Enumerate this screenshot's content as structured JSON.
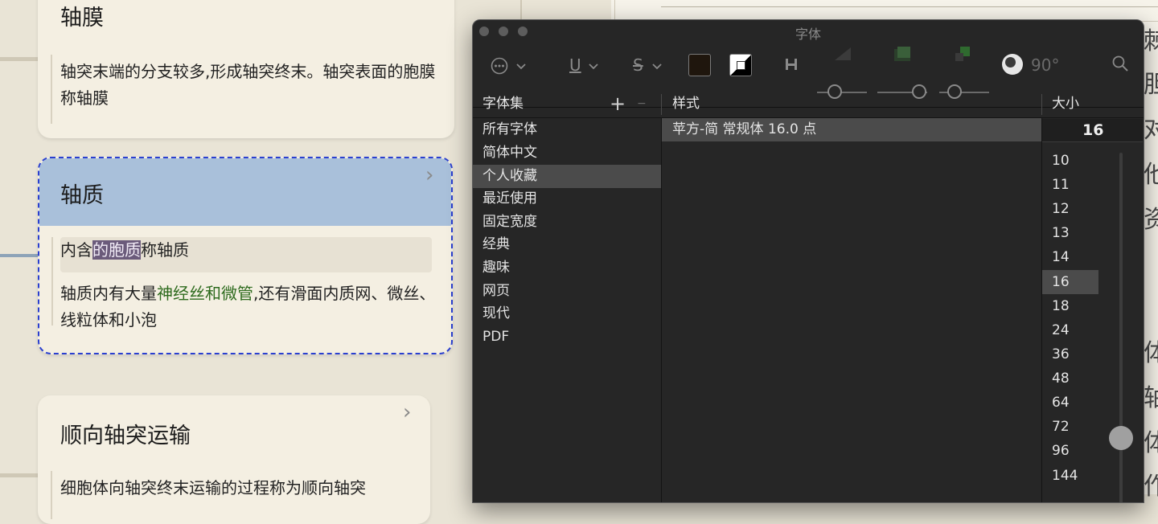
{
  "mindmap": {
    "card1": {
      "title": "轴膜",
      "body": "轴突末端的分支较多,形成轴突终末。轴突表面的胞膜称轴膜"
    },
    "card2": {
      "title": "轴质",
      "line1_pre": "内含",
      "line1_sel": "的胞质",
      "line1_post": "称轴质",
      "line2_pre": "轴质内有大量",
      "line2_green": "神经丝和微管",
      "line2_post": ",还有滑面内质网、微丝、线粒体和小泡"
    },
    "card3": {
      "title": "顺向轴突运输",
      "body": "细胞体向轴突终末运输的过程称为顺向轴突"
    }
  },
  "font_panel": {
    "title": "字体",
    "toolbar": {
      "action_icon": "ellipsis-circle-icon",
      "underline_label": "U",
      "strikethrough_label": "S",
      "text_color": "#1f160d",
      "document_color_icon": "document-color-icon",
      "angle_label": "90°",
      "search_icon": "search-icon"
    },
    "collections_header": "字体集",
    "add_label": "+",
    "remove_label": "−",
    "styles_header": "样式",
    "size_header": "大小",
    "collections": [
      "所有字体",
      "简体中文",
      "个人收藏",
      "最近使用",
      "固定宽度",
      "经典",
      "趣味",
      "网页",
      "现代",
      "PDF"
    ],
    "selected_collection": "个人收藏",
    "style_item": "苹方-简 常规体 16.0 点",
    "size_value": "16",
    "sizes": [
      "10",
      "11",
      "12",
      "13",
      "14",
      "16",
      "18",
      "24",
      "36",
      "48",
      "64",
      "72",
      "96",
      "144"
    ],
    "selected_size": "16"
  },
  "background_doc": {
    "glyphs": [
      "棘",
      "胆",
      "对",
      "他",
      "资",
      "体",
      "轴",
      "体",
      "作"
    ]
  }
}
